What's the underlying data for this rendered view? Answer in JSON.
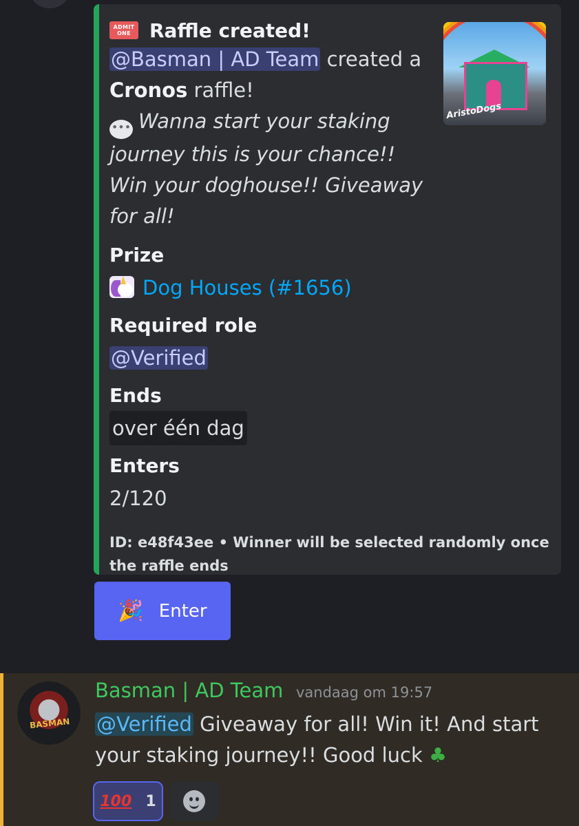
{
  "embed": {
    "accent_color": "#23a55a",
    "title_icon": "admission-ticket-icon",
    "ticket_text_top": "ADMIT",
    "ticket_text_bottom": "ONE",
    "title": "Raffle created!",
    "mention": "@Basman | AD Team",
    "created_text": " created a",
    "network": "Cronos",
    "raffle_text": " raffle!",
    "message_icon": "speech-bubble-icon",
    "description": "Wanna start your staking journey this is your chance!! Win your doghouse!! Giveaway for all!",
    "thumbnail_signature": "AristoDogs",
    "fields": {
      "prize_label": "Prize",
      "prize_icon": "unicorn-icon",
      "prize_value": "Dog Houses (#1656)",
      "role_label": "Required role",
      "role_value": "@Verified",
      "ends_label": "Ends",
      "ends_value": "over één dag",
      "enters_label": "Enters",
      "enters_value": "2/120"
    },
    "footer": "ID: e48f43ee • Winner will be selected randomly once the raffle ends"
  },
  "enter_button": {
    "icon": "party-popper-icon",
    "label": "Enter",
    "color": "#5865f2"
  },
  "message": {
    "author": "Basman | AD Team",
    "author_color": "#3ec85f",
    "avatar_text": "BASMAN",
    "timestamp": "vandaag om 19:57",
    "mention": "@Verified",
    "text_part1": " Giveaway for all! Win it! And start your staking journey!! Good luck ",
    "clover_icon": "four-leaf-clover-icon",
    "highlight_color": "#f0b232"
  },
  "reactions": [
    {
      "emoji": "100-icon",
      "label": "100",
      "count": "1"
    }
  ],
  "add_reaction_icon": "smiley-icon"
}
